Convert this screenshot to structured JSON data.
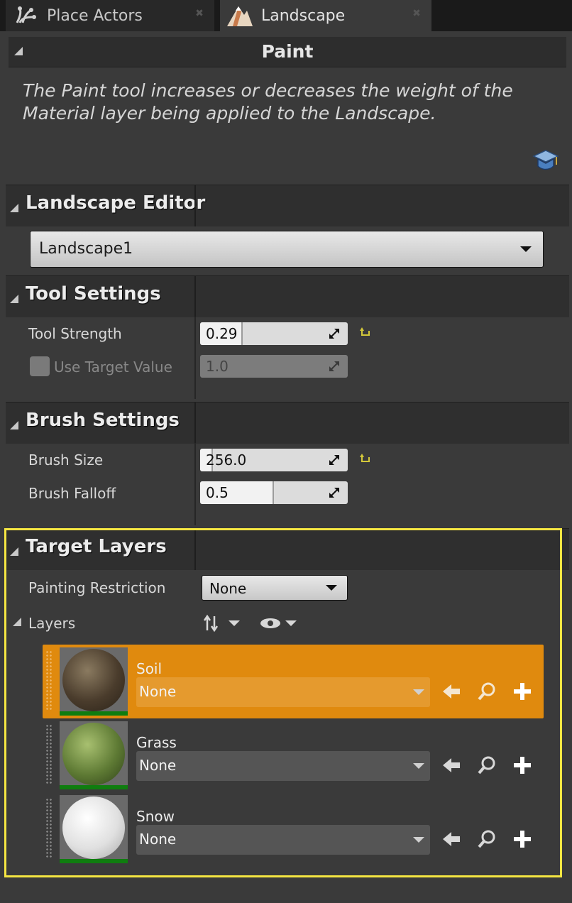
{
  "tabs": [
    {
      "label": "Place Actors",
      "icon": "place-actors-icon",
      "close_icon": "close-icon"
    },
    {
      "label": "Landscape",
      "icon": "landscape-mountain-icon",
      "close_icon": "close-icon"
    }
  ],
  "paint": {
    "title": "Paint",
    "description": "The Paint tool increases or decreases the weight of the Material layer being applied to the Landscape.",
    "doc_icon": "documentation-icon"
  },
  "landscape_editor": {
    "header": "Landscape Editor",
    "selected": "Landscape1"
  },
  "tool_settings": {
    "header": "Tool Settings",
    "tool_strength": {
      "label": "Tool Strength",
      "value": "0.29",
      "fill_fraction": 0.29
    },
    "use_target_value": {
      "label": "Use Target Value",
      "value": "1.0",
      "checked": false,
      "enabled": false
    }
  },
  "brush_settings": {
    "header": "Brush Settings",
    "brush_size": {
      "label": "Brush Size",
      "value": "256.0"
    },
    "brush_falloff": {
      "label": "Brush Falloff",
      "value": "0.5",
      "fill_fraction": 0.5
    }
  },
  "target_layers": {
    "header": "Target Layers",
    "painting_restriction": {
      "label": "Painting Restriction",
      "value": "None"
    },
    "layers_label": "Layers",
    "layers": [
      {
        "name": "Soil",
        "value": "None",
        "selected": true
      },
      {
        "name": "Grass",
        "value": "None",
        "selected": false
      },
      {
        "name": "Snow",
        "value": "None",
        "selected": false
      }
    ]
  },
  "colors": {
    "selected_row": "#e08a0e",
    "highlight_border": "#f5e642",
    "reset_arrow": "#d4c83a",
    "layer_bar": "#0f7d0f"
  }
}
